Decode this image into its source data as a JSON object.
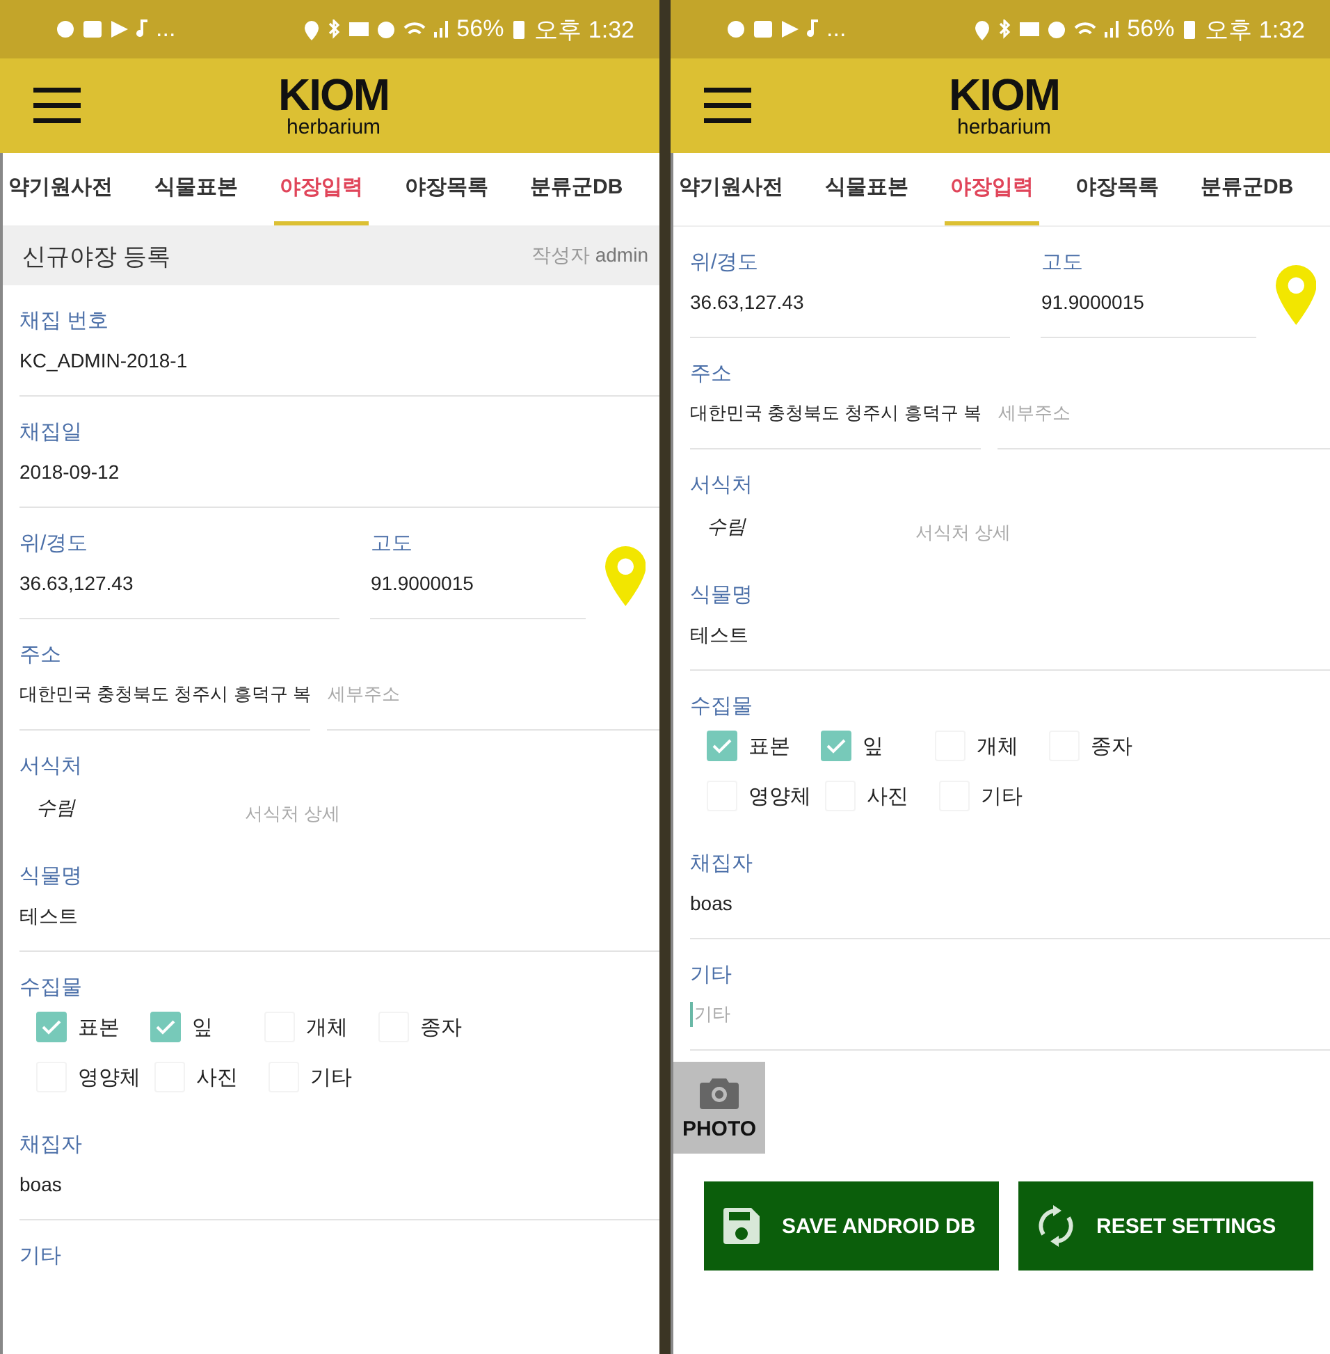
{
  "screens": [
    {
      "status_bar": {
        "more": "...",
        "battery": "56%",
        "time": "오후 1:32"
      },
      "app_bar": {
        "logo_title": "KIOM",
        "logo_subtitle": "herbarium"
      },
      "tabs": [
        {
          "label": "약기원사전",
          "selected": false
        },
        {
          "label": "식물표본",
          "selected": false
        },
        {
          "label": "야장입력",
          "selected": true
        },
        {
          "label": "야장목록",
          "selected": false
        },
        {
          "label": "분류군DB",
          "selected": false
        }
      ],
      "header": {
        "title": "신규야장 등록",
        "author_label": "작성자",
        "author": "admin"
      },
      "fields": [
        {
          "kind": "text",
          "label": "채집 번호",
          "value": "KC_ADMIN-2018-1"
        },
        {
          "kind": "text",
          "label": "채집일",
          "value": "2018-09-12"
        },
        {
          "kind": "coords",
          "label": "위/경도",
          "value": "36.63,127.43",
          "label_2": "고도",
          "value_2": "91.9000015"
        },
        {
          "kind": "pair",
          "label": "주소",
          "value": "대한민국 충청북도 청주시 흥덕구 복",
          "placeholder": "세부주소"
        },
        {
          "kind": "habitat",
          "label": "서식처",
          "value": "수림",
          "placeholder": "서식처 상세"
        },
        {
          "kind": "text",
          "label": "식물명",
          "value": "테스트"
        },
        {
          "kind": "checks",
          "label": "수집물",
          "options": [
            {
              "label": "표본",
              "checked": true
            },
            {
              "label": "잎",
              "checked": true
            },
            {
              "label": "개체",
              "checked": false
            },
            {
              "label": "종자",
              "checked": false
            },
            {
              "label": "영양체",
              "checked": false
            },
            {
              "label": "사진",
              "checked": false
            },
            {
              "label": "기타",
              "checked": false
            }
          ]
        },
        {
          "kind": "text",
          "label": "채집자",
          "value": "boas"
        },
        {
          "kind": "text",
          "label": "기타"
        }
      ]
    },
    {
      "status_bar": {
        "more": "...",
        "battery": "56%",
        "time": "오후 1:32"
      },
      "app_bar": {
        "logo_title": "KIOM",
        "logo_subtitle": "herbarium"
      },
      "tabs": [
        {
          "label": "약기원사전",
          "selected": false
        },
        {
          "label": "식물표본",
          "selected": false
        },
        {
          "label": "야장입력",
          "selected": true
        },
        {
          "label": "야장목록",
          "selected": false
        },
        {
          "label": "분류군DB",
          "selected": false
        }
      ],
      "fields": [
        {
          "kind": "coords",
          "label": "위/경도",
          "value": "36.63,127.43",
          "label_2": "고도",
          "value_2": "91.9000015"
        },
        {
          "kind": "pair",
          "label": "주소",
          "value": "대한민국 충청북도 청주시 흥덕구 복",
          "placeholder": "세부주소"
        },
        {
          "kind": "habitat",
          "label": "서식처",
          "value": "수림",
          "placeholder": "서식처 상세"
        },
        {
          "kind": "text",
          "label": "식물명",
          "value": "테스트"
        },
        {
          "kind": "checks",
          "label": "수집물",
          "options": [
            {
              "label": "표본",
              "checked": true
            },
            {
              "label": "잎",
              "checked": true
            },
            {
              "label": "개체",
              "checked": false
            },
            {
              "label": "종자",
              "checked": false
            },
            {
              "label": "영양체",
              "checked": false
            },
            {
              "label": "사진",
              "checked": false
            },
            {
              "label": "기타",
              "checked": false
            }
          ]
        },
        {
          "kind": "text",
          "label": "채집자",
          "value": "boas"
        },
        {
          "kind": "text",
          "label": "기타",
          "placeholder": "기타",
          "focused": true
        }
      ],
      "photo_button": "PHOTO",
      "buttons": [
        {
          "label": "SAVE ANDROID DB",
          "kind": "save"
        },
        {
          "label": "RESET SETTINGS",
          "kind": "reset"
        }
      ]
    }
  ]
}
